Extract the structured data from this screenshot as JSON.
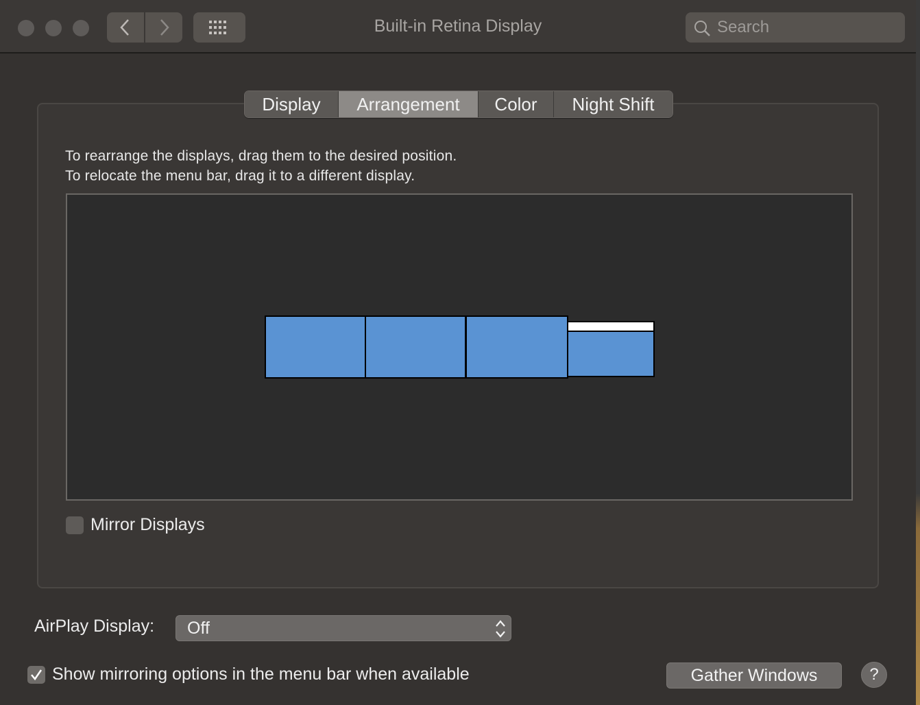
{
  "window": {
    "title": "Built-in Retina Display"
  },
  "toolbar": {
    "search_placeholder": "Search"
  },
  "tabs": [
    {
      "label": "Display"
    },
    {
      "label": "Arrangement",
      "selected": true
    },
    {
      "label": "Color"
    },
    {
      "label": "Night Shift"
    }
  ],
  "arrangement": {
    "instruction_line1": "To rearrange the displays, drag them to the desired position.",
    "instruction_line2": "To relocate the menu bar, drag it to a different display.",
    "display_color": "#5a93d3",
    "display_count": 4,
    "menu_bar_display_index": 4
  },
  "mirror": {
    "label": "Mirror Displays",
    "checked": false
  },
  "airplay": {
    "label": "AirPlay Display:",
    "value": "Off"
  },
  "show_mirroring": {
    "label": "Show mirroring options in the menu bar when available",
    "checked": true
  },
  "buttons": {
    "gather_windows": "Gather Windows",
    "help": "?"
  }
}
